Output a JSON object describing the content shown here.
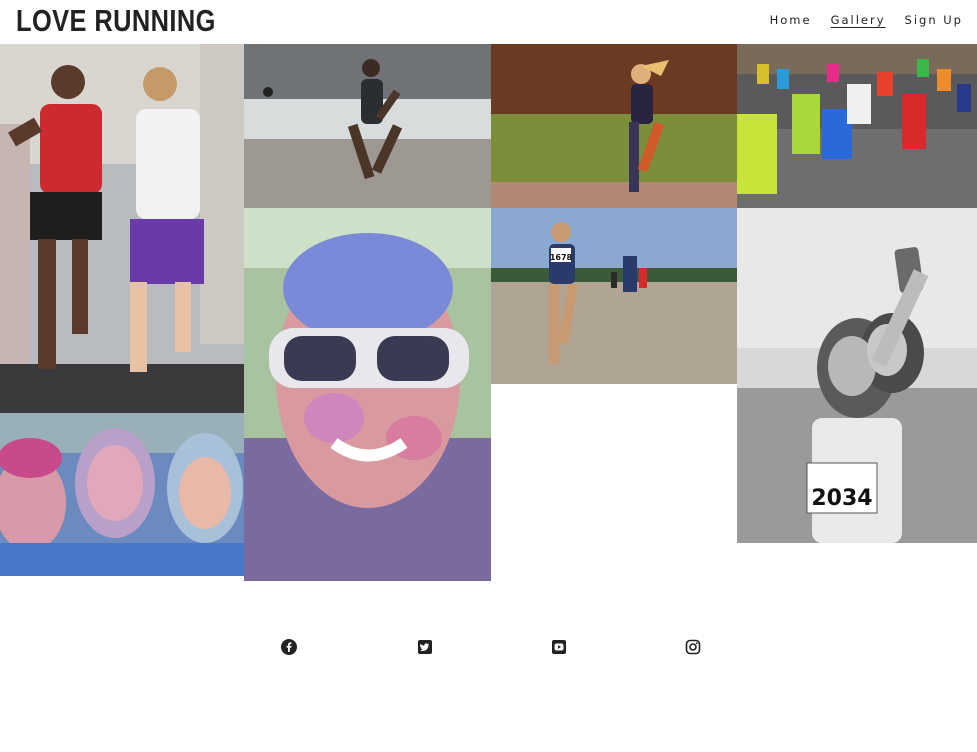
{
  "site": {
    "logo": "LOVE RUNNING"
  },
  "nav": {
    "items": [
      {
        "label": "Home",
        "active": false
      },
      {
        "label": "Gallery",
        "active": true
      },
      {
        "label": "Sign Up",
        "active": false
      }
    ]
  },
  "gallery": {
    "photos": [
      {
        "subject": "two-track-runners"
      },
      {
        "subject": "triathlete-running-on-beach"
      },
      {
        "subject": "woman-running-on-grass-path"
      },
      {
        "subject": "marathon-crowd-in-rain"
      },
      {
        "subject": "color-run-man-with-sunglasses"
      },
      {
        "subject": "woman-running-on-dirt-road",
        "bib": "1678"
      },
      {
        "subject": "black-and-white-color-run-selfie",
        "bib": "2034"
      },
      {
        "subject": "three-women-color-run"
      }
    ]
  },
  "footer": {
    "social": [
      {
        "icon": "facebook-icon"
      },
      {
        "icon": "twitter-icon"
      },
      {
        "icon": "youtube-icon"
      },
      {
        "icon": "instagram-icon"
      }
    ]
  },
  "colors": {
    "text": "#222222",
    "background": "#ffffff"
  }
}
